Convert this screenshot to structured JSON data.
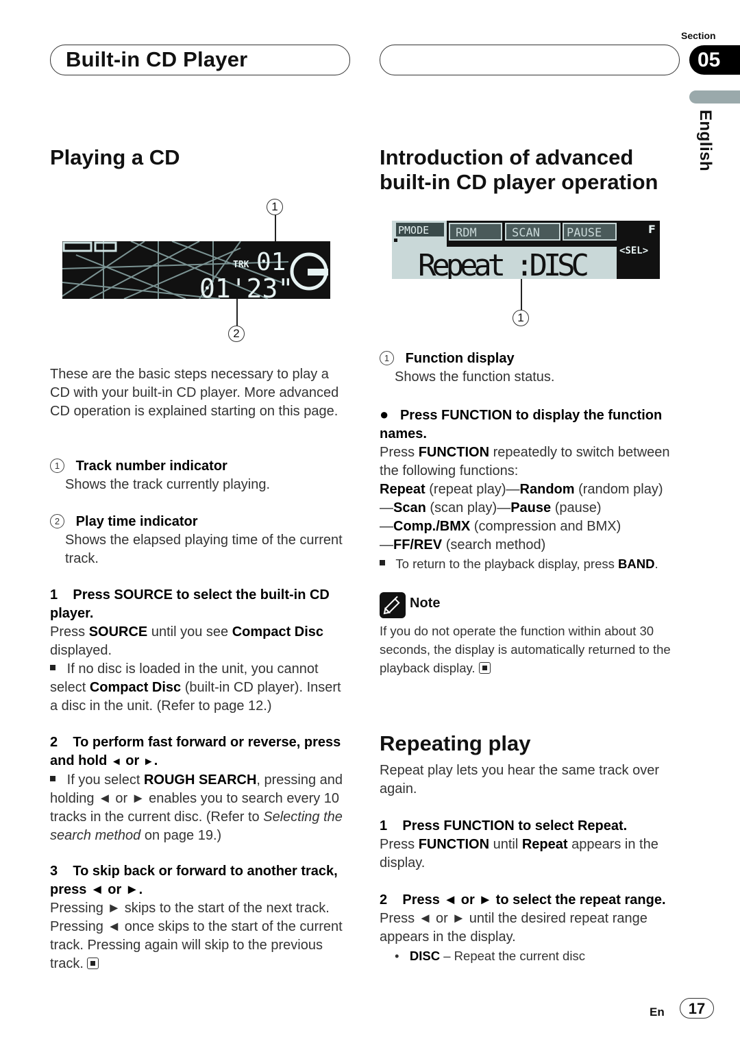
{
  "header": {
    "title": "Built-in CD Player",
    "section_label": "Section",
    "section_number": "05",
    "language_tab": "English"
  },
  "left": {
    "heading": "Playing a CD",
    "display": {
      "track_label": "TRK",
      "track_number": "01",
      "play_time": "01'23\"",
      "callouts": [
        "1",
        "2"
      ]
    },
    "intro": "These are the basic steps necessary to play a CD with your built-in CD player. More advanced CD operation is explained starting on this page.",
    "legend": [
      {
        "num": "1",
        "title": "Track number indicator",
        "desc": "Shows the track currently playing."
      },
      {
        "num": "2",
        "title": "Play time indicator",
        "desc": "Shows the elapsed playing time of the current track."
      }
    ],
    "step1": {
      "num": "1",
      "head": "Press SOURCE to select the built-in CD player.",
      "body_pre": "Press ",
      "body_b1": "SOURCE",
      "body_mid": " until you see ",
      "body_b2": "Compact Disc",
      "body_post": " displayed.",
      "note_pre": "If no disc is loaded in the unit, you cannot select ",
      "note_b": "Compact Disc",
      "note_post": " (built-in CD player). Insert a disc in the unit. (Refer to page 12.)"
    },
    "step2": {
      "num": "2",
      "head_pre": "To perform fast forward or reverse, press and hold ",
      "head_left": "◄",
      "head_or": " or ",
      "head_right": "►",
      "head_post": ".",
      "note_pre": "If you select ",
      "note_b": "ROUGH SEARCH",
      "note_mid": ", pressing and holding ◄ or ► enables you to search every 10 tracks in the current disc. (Refer to ",
      "note_i": "Selecting the search method",
      "note_post": " on page 19.)"
    },
    "step3": {
      "num": "3",
      "head": "To skip back or forward to another track, press ◄ or ►.",
      "body": "Pressing ► skips to the start of the next track. Pressing ◄ once skips to the start of the current track. Pressing again will skip to the previous track."
    }
  },
  "right": {
    "heading_line1": "Introduction of advanced",
    "heading_line2": "built-in CD player operation",
    "display": {
      "tabs": [
        "PMODE",
        "RDM",
        "SCAN",
        "PAUSE"
      ],
      "f_label": "F",
      "sel_label": "SEL",
      "main_text": "Repeat  :DISC",
      "callout": "1"
    },
    "legend": [
      {
        "num": "1",
        "title": "Function display",
        "desc": "Shows the function status."
      }
    ],
    "bullet_step": {
      "head": "Press FUNCTION to display the function names.",
      "body_pre": "Press ",
      "body_b": "FUNCTION",
      "body_post": " repeatedly to switch between the following functions:",
      "functions": [
        {
          "name": "Repeat",
          "desc": "(repeat play)"
        },
        {
          "name": "Random",
          "desc": "(random play)"
        },
        {
          "name": "Scan",
          "desc": "(scan play)"
        },
        {
          "name": "Pause",
          "desc": "(pause)"
        },
        {
          "name": "Comp./BMX",
          "desc": "(compression and BMX)"
        },
        {
          "name": "FF/REV",
          "desc": "(search method)"
        }
      ],
      "tip_pre": "To return to the playback display, press ",
      "tip_b": "BAND",
      "tip_post": "."
    },
    "note": {
      "label": "Note",
      "text": "If you do not operate the function within about 30 seconds, the display is automatically returned to the playback display."
    },
    "repeating": {
      "heading": "Repeating play",
      "intro": "Repeat play lets you hear the same track over again.",
      "step1_num": "1",
      "step1_head": "Press FUNCTION to select Repeat.",
      "step1_pre": "Press ",
      "step1_b1": "FUNCTION",
      "step1_mid": " until ",
      "step1_b2": "Repeat",
      "step1_post": " appears in the display.",
      "step2_num": "2",
      "step2_head": "Press ◄ or ► to select the repeat range.",
      "step2_body": "Press ◄ or ► until the desired repeat range appears in the display.",
      "options": [
        {
          "name": "DISC",
          "desc": " – Repeat the current disc"
        }
      ]
    }
  },
  "footer": {
    "lang": "En",
    "page": "17"
  }
}
